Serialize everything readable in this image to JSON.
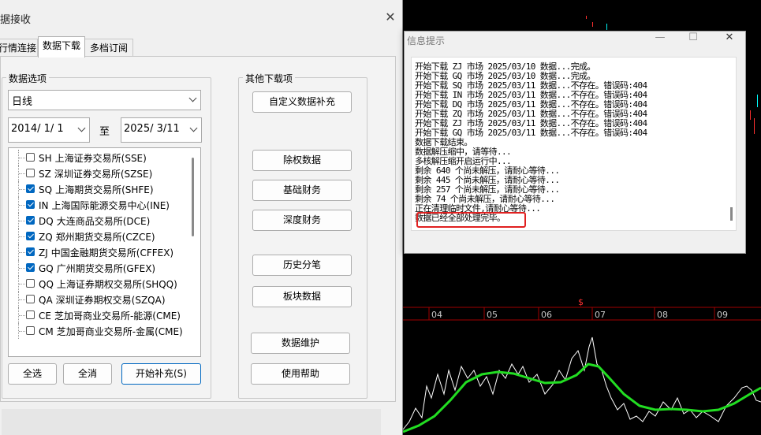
{
  "data_dialog": {
    "title": "据接收",
    "close_glyph": "✕",
    "tabs": [
      {
        "label": "行情连接"
      },
      {
        "label": "数据下载"
      },
      {
        "label": "多档订阅"
      }
    ],
    "data_options_label": "数据选项",
    "period_select": "日线",
    "start_date": "2014/ 1/ 1",
    "to_label": "至",
    "end_date": "2025/ 3/11",
    "markets": [
      {
        "code": "SH",
        "name": "上海证券交易所(SSE)",
        "checked": false
      },
      {
        "code": "SZ",
        "name": "深圳证券交易所(SZSE)",
        "checked": false
      },
      {
        "code": "SQ",
        "name": "上海期货交易所(SHFE)",
        "checked": true
      },
      {
        "code": "IN",
        "name": "上海国际能源交易中心(INE)",
        "checked": true
      },
      {
        "code": "DQ",
        "name": "大连商品交易所(DCE)",
        "checked": true
      },
      {
        "code": "ZQ",
        "name": "郑州期货交易所(CZCE)",
        "checked": true
      },
      {
        "code": "ZJ",
        "name": "中国金融期货交易所(CFFEX)",
        "checked": true
      },
      {
        "code": "GQ",
        "name": "广州期货交易所(GFEX)",
        "checked": true
      },
      {
        "code": "QQ",
        "name": "上海证券期权交易所(SHQQ)",
        "checked": false
      },
      {
        "code": "QA",
        "name": "深圳证券期权交易(SZQA)",
        "checked": false
      },
      {
        "code": "CE",
        "name": "芝加哥商业交易所-能源(CME)",
        "checked": false
      },
      {
        "code": "CM",
        "name": "芝加哥商业交易所-金属(CME)",
        "checked": false
      }
    ],
    "select_all": "全选",
    "deselect_all": "全消",
    "start_button": "开始补充(S)",
    "other_downloads_label": "其他下载项",
    "custom_button": "自定义数据补充",
    "side_buttons": [
      "除权数据",
      "基础财务",
      "深度财务",
      "历史分笔",
      "板块数据"
    ],
    "maintain_button": "数据维护",
    "help_button": "使用帮助"
  },
  "info_window": {
    "title": "信息提示",
    "minimize_glyph": "—",
    "maximize_glyph": "☐",
    "close_glyph": "✕",
    "log_lines": [
      "开始下载 ZJ 市场 2025/03/10 数据...完成。",
      "开始下载 GQ 市场 2025/03/10 数据...完成。",
      "开始下载 SQ 市场 2025/03/11 数据...不存在。错误码:404",
      "开始下载 IN 市场 2025/03/11 数据...不存在。错误码:404",
      "开始下载 DQ 市场 2025/03/11 数据...不存在。错误码:404",
      "开始下载 ZQ 市场 2025/03/11 数据...不存在。错误码:404",
      "开始下载 ZJ 市场 2025/03/11 数据...不存在。错误码:404",
      "开始下载 GQ 市场 2025/03/11 数据...不存在。错误码:404",
      "数据下载结束。",
      "数据解压缩中，请等待...",
      "多核解压缩开启运行中...",
      "剩余 640 个尚未解压，请耐心等待...",
      "剩余 445 个尚未解压，请耐心等待...",
      "剩余 257 个尚未解压，请耐心等待...",
      "剩余 74 个尚未解压，请耐心等待...",
      "正在清理临时文件,请耐心等待...",
      "数据已经全部处理完毕。"
    ],
    "highlight_color": "#e02020"
  },
  "chart": {
    "month_labels": [
      "04",
      "05",
      "06",
      "07",
      "08",
      "09"
    ],
    "marker": "$",
    "colors": {
      "price": "#ffffff",
      "average": "#22dd22",
      "axis": "#c00000",
      "marker": "#ff3030"
    }
  }
}
